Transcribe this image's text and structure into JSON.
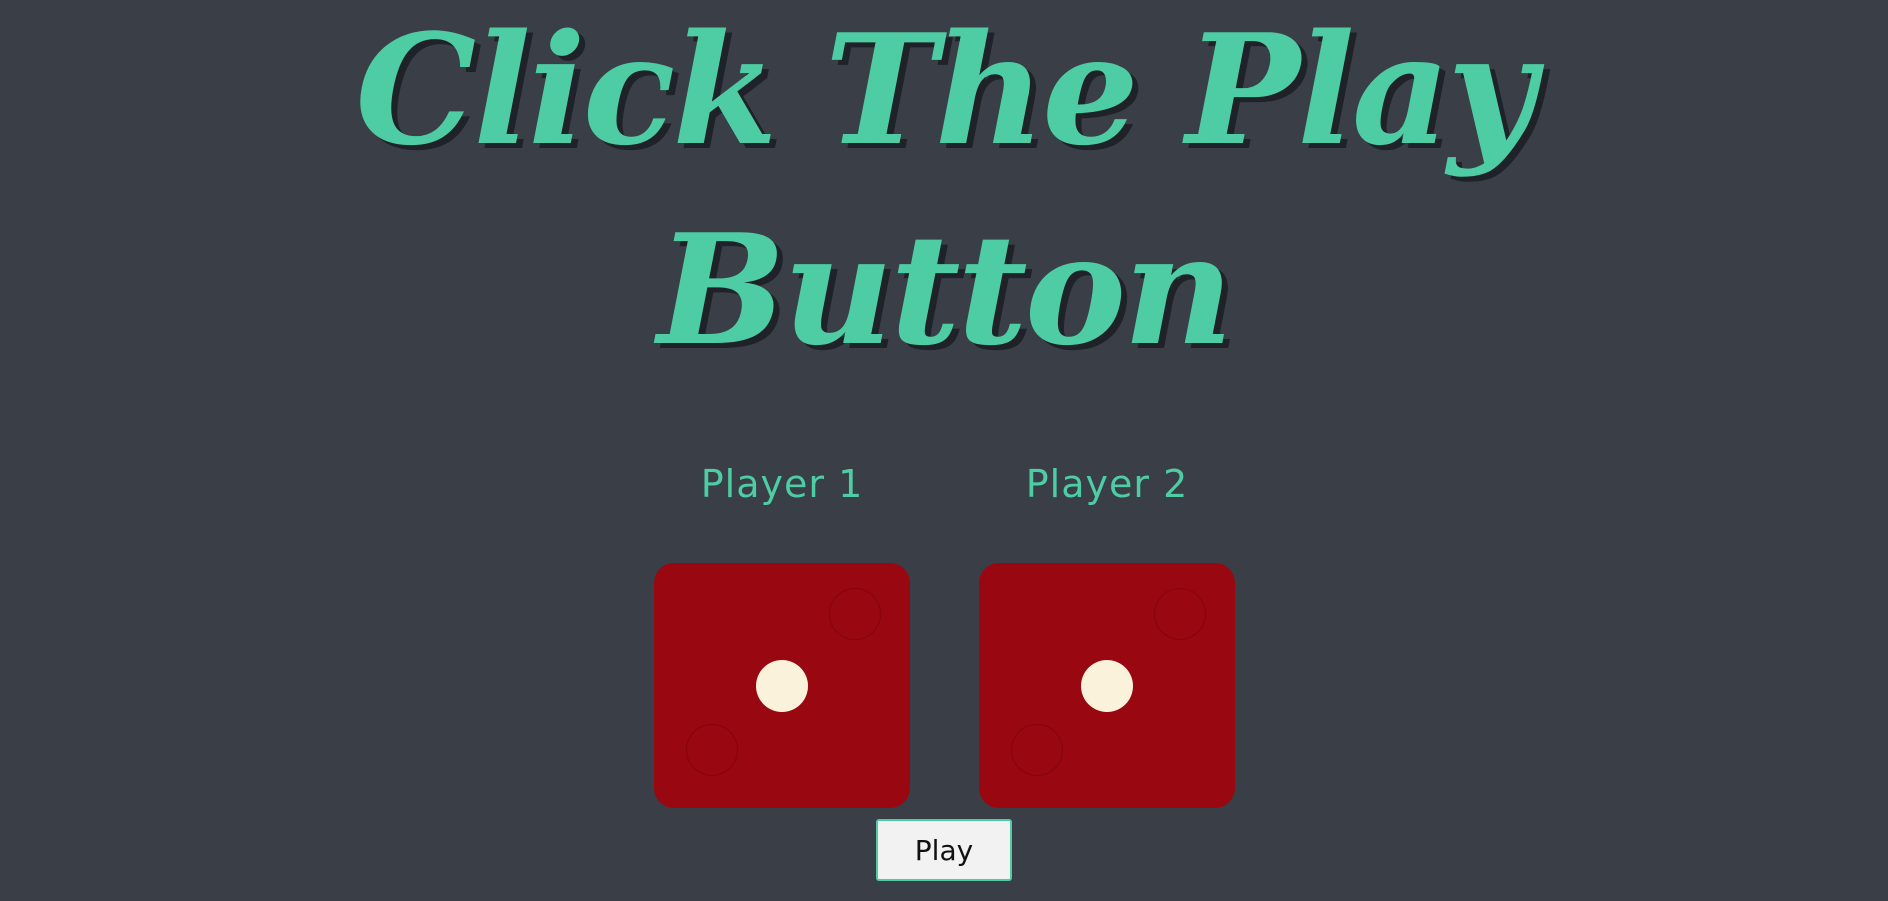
{
  "title": {
    "line1": "Click The Play",
    "line2": "Button"
  },
  "players": [
    {
      "label": "Player 1",
      "die_value": 1
    },
    {
      "label": "Player 2",
      "die_value": 1
    }
  ],
  "play_button": {
    "label": "Play"
  },
  "colors": {
    "background": "#393e47",
    "accent": "#4ecca3",
    "die": "#990710",
    "pip": "#fbf2dc",
    "button": "#f2f2f2"
  }
}
